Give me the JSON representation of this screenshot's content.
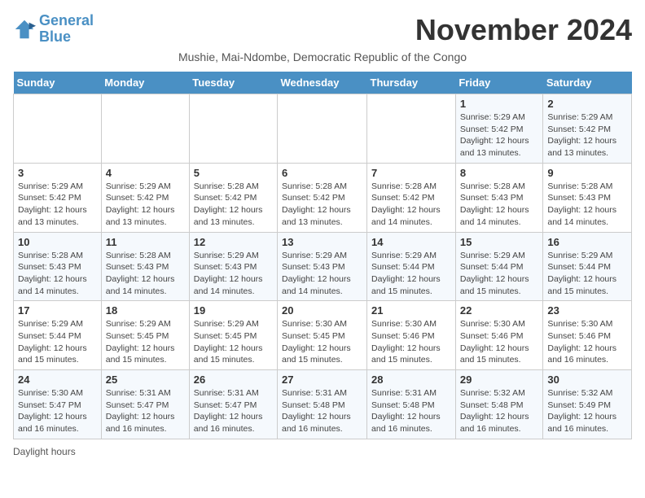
{
  "header": {
    "logo_line1": "General",
    "logo_line2": "Blue",
    "month_title": "November 2024",
    "subtitle": "Mushie, Mai-Ndombe, Democratic Republic of the Congo"
  },
  "days_of_week": [
    "Sunday",
    "Monday",
    "Tuesday",
    "Wednesday",
    "Thursday",
    "Friday",
    "Saturday"
  ],
  "weeks": [
    [
      {
        "day": "",
        "info": ""
      },
      {
        "day": "",
        "info": ""
      },
      {
        "day": "",
        "info": ""
      },
      {
        "day": "",
        "info": ""
      },
      {
        "day": "",
        "info": ""
      },
      {
        "day": "1",
        "info": "Sunrise: 5:29 AM\nSunset: 5:42 PM\nDaylight: 12 hours\nand 13 minutes."
      },
      {
        "day": "2",
        "info": "Sunrise: 5:29 AM\nSunset: 5:42 PM\nDaylight: 12 hours\nand 13 minutes."
      }
    ],
    [
      {
        "day": "3",
        "info": "Sunrise: 5:29 AM\nSunset: 5:42 PM\nDaylight: 12 hours\nand 13 minutes."
      },
      {
        "day": "4",
        "info": "Sunrise: 5:29 AM\nSunset: 5:42 PM\nDaylight: 12 hours\nand 13 minutes."
      },
      {
        "day": "5",
        "info": "Sunrise: 5:28 AM\nSunset: 5:42 PM\nDaylight: 12 hours\nand 13 minutes."
      },
      {
        "day": "6",
        "info": "Sunrise: 5:28 AM\nSunset: 5:42 PM\nDaylight: 12 hours\nand 13 minutes."
      },
      {
        "day": "7",
        "info": "Sunrise: 5:28 AM\nSunset: 5:42 PM\nDaylight: 12 hours\nand 14 minutes."
      },
      {
        "day": "8",
        "info": "Sunrise: 5:28 AM\nSunset: 5:43 PM\nDaylight: 12 hours\nand 14 minutes."
      },
      {
        "day": "9",
        "info": "Sunrise: 5:28 AM\nSunset: 5:43 PM\nDaylight: 12 hours\nand 14 minutes."
      }
    ],
    [
      {
        "day": "10",
        "info": "Sunrise: 5:28 AM\nSunset: 5:43 PM\nDaylight: 12 hours\nand 14 minutes."
      },
      {
        "day": "11",
        "info": "Sunrise: 5:28 AM\nSunset: 5:43 PM\nDaylight: 12 hours\nand 14 minutes."
      },
      {
        "day": "12",
        "info": "Sunrise: 5:29 AM\nSunset: 5:43 PM\nDaylight: 12 hours\nand 14 minutes."
      },
      {
        "day": "13",
        "info": "Sunrise: 5:29 AM\nSunset: 5:43 PM\nDaylight: 12 hours\nand 14 minutes."
      },
      {
        "day": "14",
        "info": "Sunrise: 5:29 AM\nSunset: 5:44 PM\nDaylight: 12 hours\nand 15 minutes."
      },
      {
        "day": "15",
        "info": "Sunrise: 5:29 AM\nSunset: 5:44 PM\nDaylight: 12 hours\nand 15 minutes."
      },
      {
        "day": "16",
        "info": "Sunrise: 5:29 AM\nSunset: 5:44 PM\nDaylight: 12 hours\nand 15 minutes."
      }
    ],
    [
      {
        "day": "17",
        "info": "Sunrise: 5:29 AM\nSunset: 5:44 PM\nDaylight: 12 hours\nand 15 minutes."
      },
      {
        "day": "18",
        "info": "Sunrise: 5:29 AM\nSunset: 5:45 PM\nDaylight: 12 hours\nand 15 minutes."
      },
      {
        "day": "19",
        "info": "Sunrise: 5:29 AM\nSunset: 5:45 PM\nDaylight: 12 hours\nand 15 minutes."
      },
      {
        "day": "20",
        "info": "Sunrise: 5:30 AM\nSunset: 5:45 PM\nDaylight: 12 hours\nand 15 minutes."
      },
      {
        "day": "21",
        "info": "Sunrise: 5:30 AM\nSunset: 5:46 PM\nDaylight: 12 hours\nand 15 minutes."
      },
      {
        "day": "22",
        "info": "Sunrise: 5:30 AM\nSunset: 5:46 PM\nDaylight: 12 hours\nand 15 minutes."
      },
      {
        "day": "23",
        "info": "Sunrise: 5:30 AM\nSunset: 5:46 PM\nDaylight: 12 hours\nand 16 minutes."
      }
    ],
    [
      {
        "day": "24",
        "info": "Sunrise: 5:30 AM\nSunset: 5:47 PM\nDaylight: 12 hours\nand 16 minutes."
      },
      {
        "day": "25",
        "info": "Sunrise: 5:31 AM\nSunset: 5:47 PM\nDaylight: 12 hours\nand 16 minutes."
      },
      {
        "day": "26",
        "info": "Sunrise: 5:31 AM\nSunset: 5:47 PM\nDaylight: 12 hours\nand 16 minutes."
      },
      {
        "day": "27",
        "info": "Sunrise: 5:31 AM\nSunset: 5:48 PM\nDaylight: 12 hours\nand 16 minutes."
      },
      {
        "day": "28",
        "info": "Sunrise: 5:31 AM\nSunset: 5:48 PM\nDaylight: 12 hours\nand 16 minutes."
      },
      {
        "day": "29",
        "info": "Sunrise: 5:32 AM\nSunset: 5:48 PM\nDaylight: 12 hours\nand 16 minutes."
      },
      {
        "day": "30",
        "info": "Sunrise: 5:32 AM\nSunset: 5:49 PM\nDaylight: 12 hours\nand 16 minutes."
      }
    ]
  ],
  "footer": {
    "daylight_label": "Daylight hours"
  }
}
